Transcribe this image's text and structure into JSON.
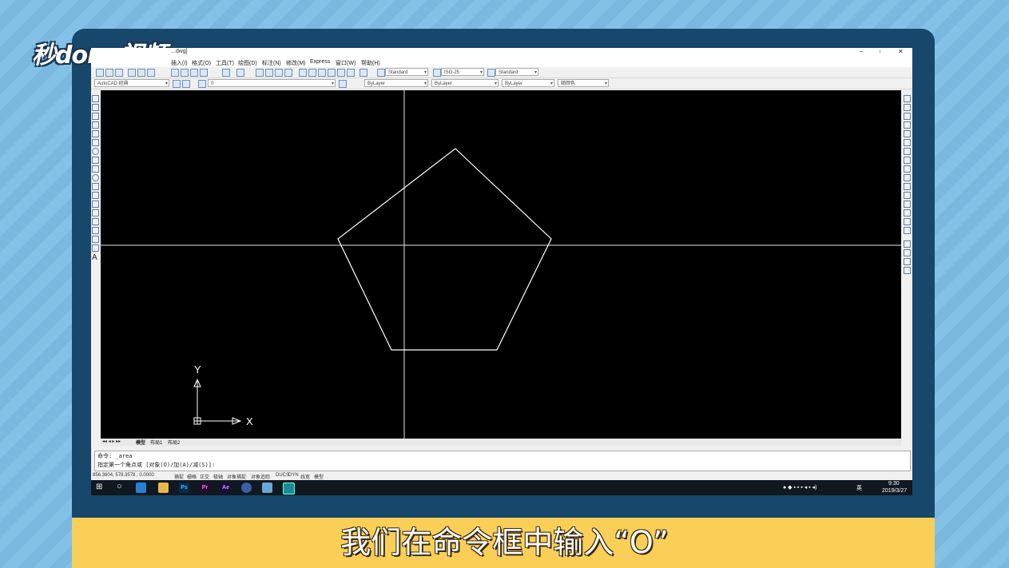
{
  "logo_text": "秒dong视频",
  "caption": "我们在命令框中输入“O”",
  "window": {
    "title": "...dwg]",
    "minimize": "–",
    "maximize": "▫",
    "close": "✕"
  },
  "menu": [
    "插入(I)",
    "格式(O)",
    "工具(T)",
    "绘图(D)",
    "标注(N)",
    "修改(M)",
    "Express",
    "窗口(W)",
    "帮助(H)"
  ],
  "toolbar": {
    "text_style": "Standard",
    "dim_style": "ISO-25",
    "table_style": "Standard",
    "workspace": "AutoCAD 经典",
    "layer": "0",
    "color": "ByLayer",
    "linetype": "ByLayer",
    "lineweight": "ByLayer",
    "plotstyle": "随颜色"
  },
  "ucs": {
    "x_label": "X",
    "y_label": "Y"
  },
  "layout_tabs": [
    "模型",
    "布局1",
    "布局2"
  ],
  "command": {
    "line1": "命令: _area",
    "line2": "指定第一个角点或 [对象(O)/加(A)/减(S)]:"
  },
  "status": {
    "coords": "856.3604, 578.3578 , 0.0000",
    "toggles": [
      "捕捉",
      "栅格",
      "正交",
      "极轴",
      "对象捕捉",
      "对象追踪",
      "DUCS",
      "DYN",
      "线宽",
      "模型"
    ]
  },
  "taskbar": {
    "time": "9:30",
    "date": "2019/3/27",
    "ime": "英",
    "apps": [
      "Ps",
      "Pr",
      "Ae"
    ]
  },
  "colors": {
    "canvas": "#000000",
    "geometry": "#ffffff",
    "accent": "#f9cf57",
    "frame": "#17476b"
  }
}
